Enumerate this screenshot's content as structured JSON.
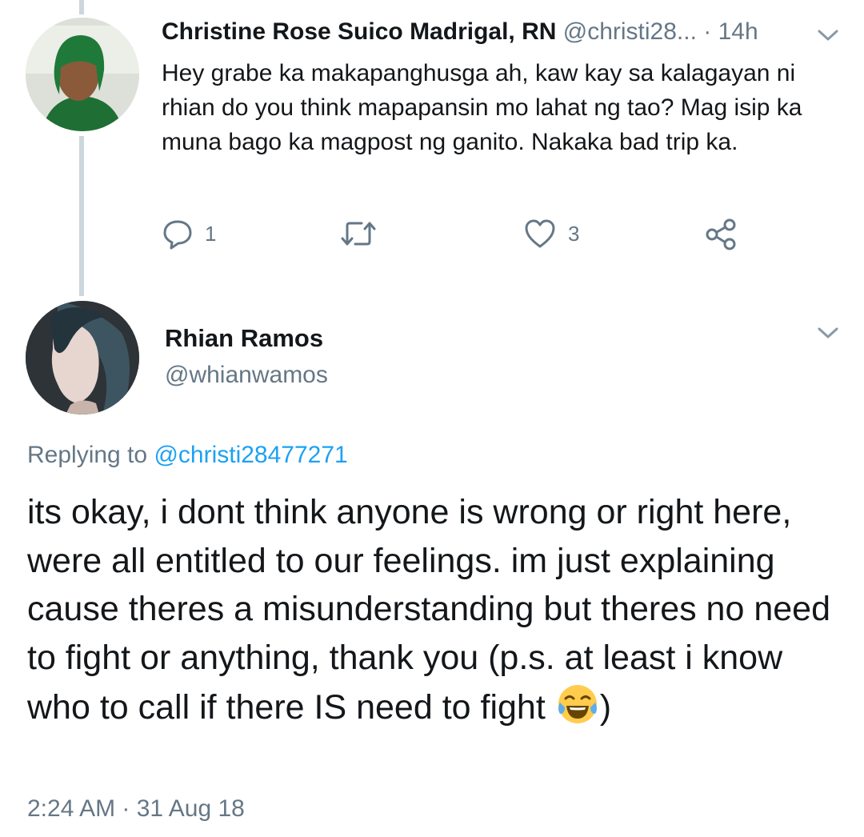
{
  "tweet1": {
    "author_name": "Christine Rose Suico Madrigal, RN",
    "handle": "@christi28...",
    "time": " · 14h",
    "text": "Hey grabe ka makapanghusga ah, kaw kay sa kalagayan ni rhian do you think mapapansin mo lahat ng tao?  Mag isip ka muna bago ka magpost ng ganito. Nakaka bad trip ka.",
    "reply_count": "1",
    "like_count": "3"
  },
  "tweet2": {
    "author_name": "Rhian Ramos",
    "handle": "@whianwamos",
    "replying_prefix": "Replying to ",
    "replying_handle": "@christi28477271",
    "text": "its okay, i dont think anyone is wrong or right here, were all entitled to our feelings. im just explaining cause theres a misunderstanding but theres no need to fight or anything, thank you (p.s. at least i know who to call if there IS need to fight ",
    "text_end": ")",
    "timestamp": "2:24 AM · 31 Aug 18"
  },
  "icons": {
    "reply": "reply-icon",
    "retweet": "retweet-icon",
    "like": "heart-icon",
    "share": "share-icon",
    "menu": "chevron-down-icon",
    "emoji": "tears-of-joy-emoji"
  },
  "colors": {
    "text": "#14171a",
    "muted": "#657786",
    "link": "#1da1f2",
    "thread_line": "#ccd6dd"
  }
}
